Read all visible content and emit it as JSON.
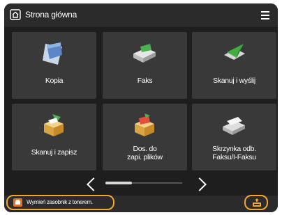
{
  "header": {
    "title": "Strona główna",
    "home_icon": "home-icon",
    "menu_icon": "hamburger-menu-icon"
  },
  "tiles": [
    {
      "label": "Kopia",
      "icon": "copy-icon"
    },
    {
      "label": "Faks",
      "icon": "fax-icon"
    },
    {
      "label": "Skanuj i wyślij",
      "icon": "scan-and-send-icon"
    },
    {
      "label": "Skanuj i zapisz",
      "icon": "scan-and-save-icon"
    },
    {
      "label_line1": "Dos. do",
      "label_line2": "zapi. plików",
      "icon": "access-stored-files-icon"
    },
    {
      "label_line1": "Skrzynka odb.",
      "label_line2": "Faksu/I-Faksu",
      "icon": "fax-inbox-icon"
    }
  ],
  "pagination": {
    "prev_icon": "chevron-left-icon",
    "next_icon": "chevron-right-icon"
  },
  "status": {
    "message": "Wymień zasobnik z tonerem.",
    "icon": "toner-warning-icon"
  },
  "status_monitor": {
    "icon": "status-monitor-icon"
  },
  "colors": {
    "accent": "#f2a72b",
    "tile": "#393939",
    "background": "#1e1e1e"
  }
}
